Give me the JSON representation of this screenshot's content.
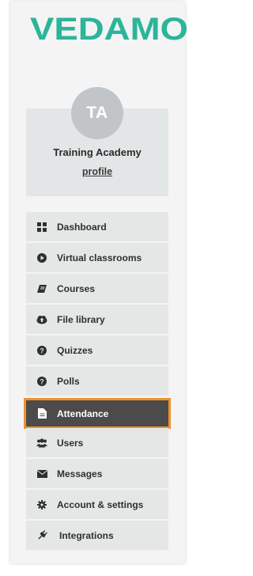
{
  "brand": {
    "logo_text": "VEDAMO",
    "logo_color": "#2bb59a"
  },
  "profile": {
    "avatar_initials": "TA",
    "name": "Training Academy",
    "link_label": "profile"
  },
  "nav": {
    "items": [
      {
        "label": "Dashboard",
        "icon": "dashboard-icon"
      },
      {
        "label": "Virtual classrooms",
        "icon": "play-circle-icon"
      },
      {
        "label": "Courses",
        "icon": "book-icon"
      },
      {
        "label": "File library",
        "icon": "cloud-upload-icon"
      },
      {
        "label": "Quizzes",
        "icon": "question-circle-icon"
      },
      {
        "label": "Polls",
        "icon": "question-circle-icon"
      },
      {
        "label": "Attendance",
        "icon": "document-icon",
        "active": true
      },
      {
        "label": "Users",
        "icon": "users-icon"
      },
      {
        "label": "Messages",
        "icon": "envelope-icon"
      },
      {
        "label": "Account & settings",
        "icon": "gear-icon"
      },
      {
        "label": "Integrations",
        "icon": "plug-icon"
      }
    ],
    "active_color": "#4b4b4b",
    "active_outline": "#f0912e"
  }
}
